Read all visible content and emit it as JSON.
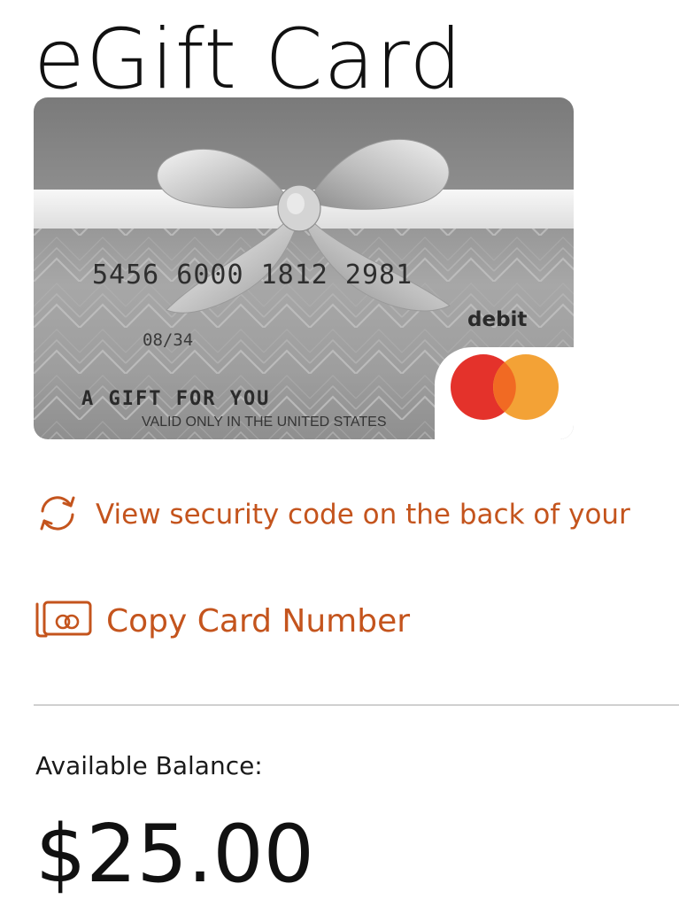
{
  "page": {
    "title": "eGift Card"
  },
  "card": {
    "number": "5456 6000 1812 2981",
    "expiry": "08/34",
    "gift_text": "A GIFT FOR YOU",
    "validity": "VALID ONLY IN THE UNITED STATES",
    "type": "debit",
    "network_logo": "mastercard-logo",
    "colors": {
      "mastercard_red": "#e4322b",
      "mastercard_orange": "#f3a236"
    }
  },
  "actions": {
    "security": {
      "label": "View security code on the back of your",
      "icon": "refresh-icon"
    },
    "copy": {
      "label": "Copy Card Number",
      "icon": "card-copy-icon"
    },
    "accent_color": "#c4541d"
  },
  "balance": {
    "label": "Available Balance:",
    "amount": "$25.00"
  }
}
